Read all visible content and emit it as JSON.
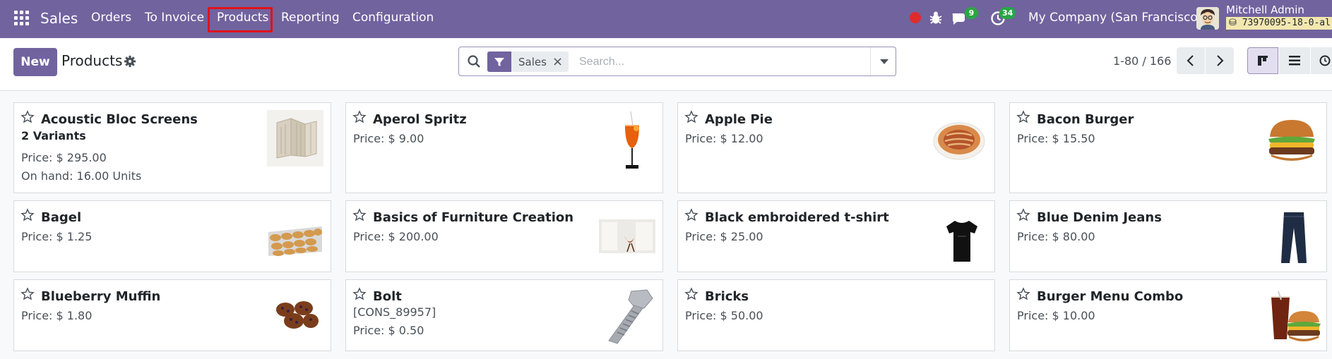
{
  "navbar": {
    "brand": "Sales",
    "menu": [
      "Orders",
      "To Invoice",
      "Products",
      "Reporting",
      "Configuration"
    ],
    "messages_count": "9",
    "activities_count": "34",
    "company": "My Company (San Francisco)",
    "user_name": "Mitchell Admin",
    "database": "73970095-18-0-al",
    "icons": [
      "apps-icon",
      "recording-dot-icon",
      "bug-icon",
      "chat-icon",
      "clock-icon",
      "database-icon"
    ]
  },
  "control_panel": {
    "new_label": "New",
    "title": "Products",
    "search": {
      "facet_label": "Sales",
      "placeholder": "Search..."
    },
    "pager": "1-80 / 166"
  },
  "products": [
    {
      "name": "Acoustic Bloc Screens",
      "variants": "2 Variants",
      "lines": [
        "Price: $ 295.00",
        "On hand: 16.00 Units"
      ],
      "image": "acoustic-screen-image"
    },
    {
      "name": "Aperol Spritz",
      "lines": [
        "Price: $ 9.00"
      ],
      "image": "cocktail-glass-image"
    },
    {
      "name": "Apple Pie",
      "lines": [
        "Price: $ 12.00"
      ],
      "image": "pie-image"
    },
    {
      "name": "Bacon Burger",
      "lines": [
        "Price: $ 15.50"
      ],
      "image": "burger-image"
    },
    {
      "name": "Bagel",
      "lines": [
        "Price: $ 1.25"
      ],
      "image": "bagels-tray-image"
    },
    {
      "name": "Basics of Furniture Creation",
      "lines": [
        "Price: $ 200.00"
      ],
      "image": "furniture-room-image"
    },
    {
      "name": "Black embroidered t-shirt",
      "lines": [
        "Price: $ 25.00"
      ],
      "image": "tshirt-image"
    },
    {
      "name": "Blue Denim Jeans",
      "lines": [
        "Price: $ 80.00"
      ],
      "image": "jeans-image"
    },
    {
      "name": "Blueberry Muffin",
      "lines": [
        "Price: $ 1.80"
      ],
      "image": "muffins-image"
    },
    {
      "name": "Bolt",
      "lines": [
        "[CONS_89957]",
        "Price: $ 0.50"
      ],
      "image": "bolt-image"
    },
    {
      "name": "Bricks",
      "lines": [
        "Price: $ 50.00"
      ],
      "image": ""
    },
    {
      "name": "Burger Menu Combo",
      "lines": [
        "Price: $ 10.00"
      ],
      "image": "burger-combo-image"
    }
  ],
  "colors": {
    "brand": "#71639e",
    "badge": "#28a745",
    "highlight": "#e0131a"
  }
}
